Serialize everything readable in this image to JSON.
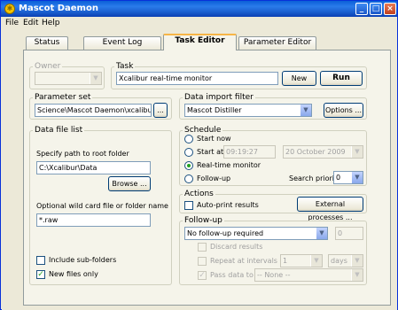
{
  "window": {
    "title": "Mascot Daemon",
    "app_icon": "mascot-icon",
    "min": "_",
    "max": "□",
    "close": "×"
  },
  "menu": [
    "File",
    "Edit",
    "Help"
  ],
  "tabs": [
    {
      "label": "Status",
      "active": false
    },
    {
      "label": "Event Log",
      "active": false
    },
    {
      "label": "Task Editor",
      "active": true
    },
    {
      "label": "Parameter Editor",
      "active": false
    }
  ],
  "owner": {
    "label": "Owner",
    "value": ""
  },
  "task": {
    "label": "Task",
    "value": "Xcalibur real-time monitor",
    "new_label": "New",
    "run_label": "Run"
  },
  "parameter_set": {
    "label": "Parameter set",
    "value": "Science\\Mascot Daemon\\xcalibur.par",
    "browse_label": "..."
  },
  "data_import": {
    "label": "Data import filter",
    "value": "Mascot Distiller",
    "options_label": "Options ..."
  },
  "data_file_list": {
    "label": "Data file list",
    "root_label": "Specify path to root folder",
    "root_value": "C:\\Xcalibur\\Data",
    "browse_label": "Browse ...",
    "wildcard_label": "Optional wild card file or folder name",
    "wildcard_value": "*.raw",
    "include_sub_label": "Include sub-folders",
    "include_sub_checked": false,
    "new_files_label": "New files only",
    "new_files_checked": true,
    "check_mark": "✓"
  },
  "schedule": {
    "label": "Schedule",
    "start_now": "Start now",
    "start_at": "Start at",
    "time": "09:19:27",
    "date": "20  October  2009",
    "realtime": "Real-time monitor",
    "followup": "Follow-up",
    "priority_label": "Search priority",
    "priority_value": "0",
    "selected": "realtime"
  },
  "actions": {
    "label": "Actions",
    "autoprint_label": "Auto-print results",
    "external_label": "External processes ..."
  },
  "follow_up": {
    "label": "Follow-up",
    "mode": "No follow-up required",
    "count": "0",
    "discard_label": "Discard results",
    "repeat_label": "Repeat at intervals of",
    "repeat_value": "1",
    "repeat_unit": "days",
    "pass_label": "Pass data to",
    "pass_value": "-- None --",
    "check_mark": "✓"
  }
}
